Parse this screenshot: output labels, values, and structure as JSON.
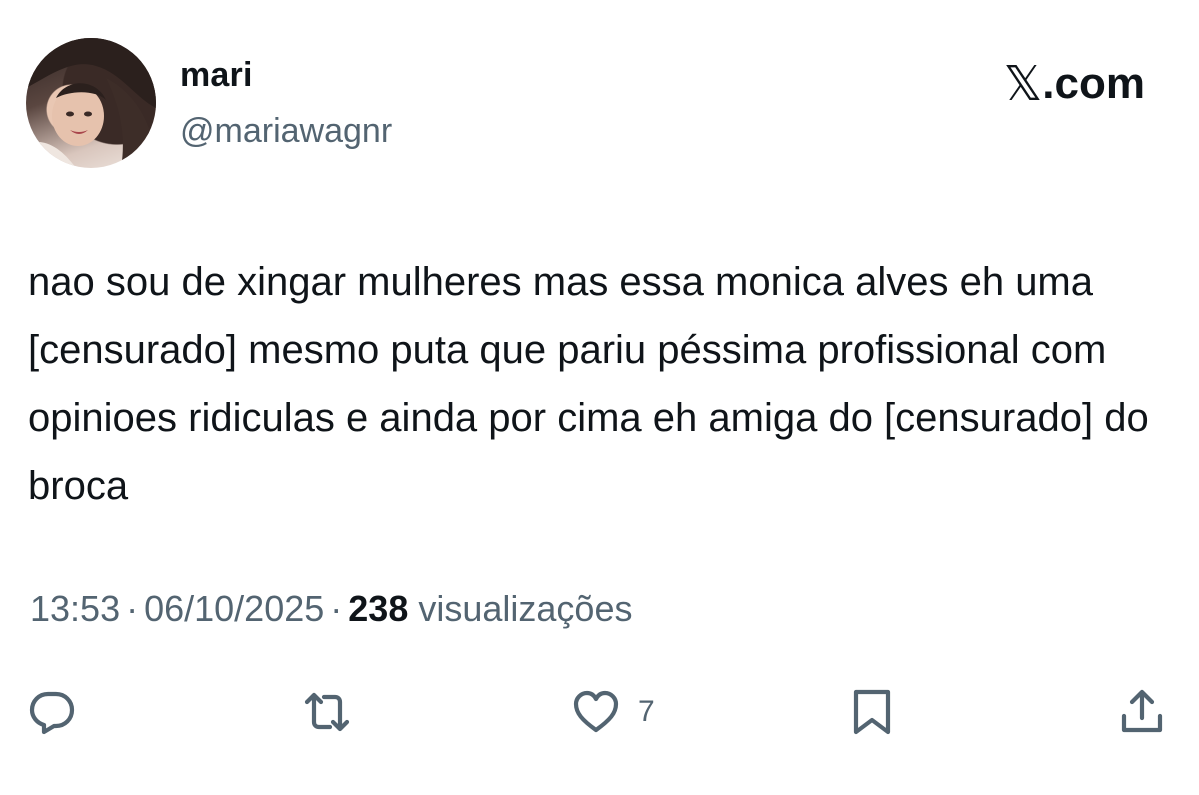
{
  "author": {
    "name": "mari",
    "handle": "@mariawagnr"
  },
  "brand": {
    "x_glyph": "𝕏",
    "suffix": ".com"
  },
  "tweet": {
    "text": "nao sou de xingar mulheres mas essa monica alves eh uma [censurado] mesmo puta que pariu péssima profissional com opinioes ridiculas e ainda por cima eh amiga do [censurado] do broca"
  },
  "meta": {
    "time": "13:53",
    "separator": "·",
    "date": "06/10/2025",
    "views_count": "238",
    "views_label": "visualizações"
  },
  "actions": {
    "reply_icon": "reply-icon",
    "repost_icon": "repost-icon",
    "like_icon": "heart-icon",
    "like_count": "7",
    "bookmark_icon": "bookmark-icon",
    "share_icon": "share-icon"
  },
  "colors": {
    "text": "#0f1419",
    "secondary": "#536471",
    "background": "#ffffff"
  }
}
